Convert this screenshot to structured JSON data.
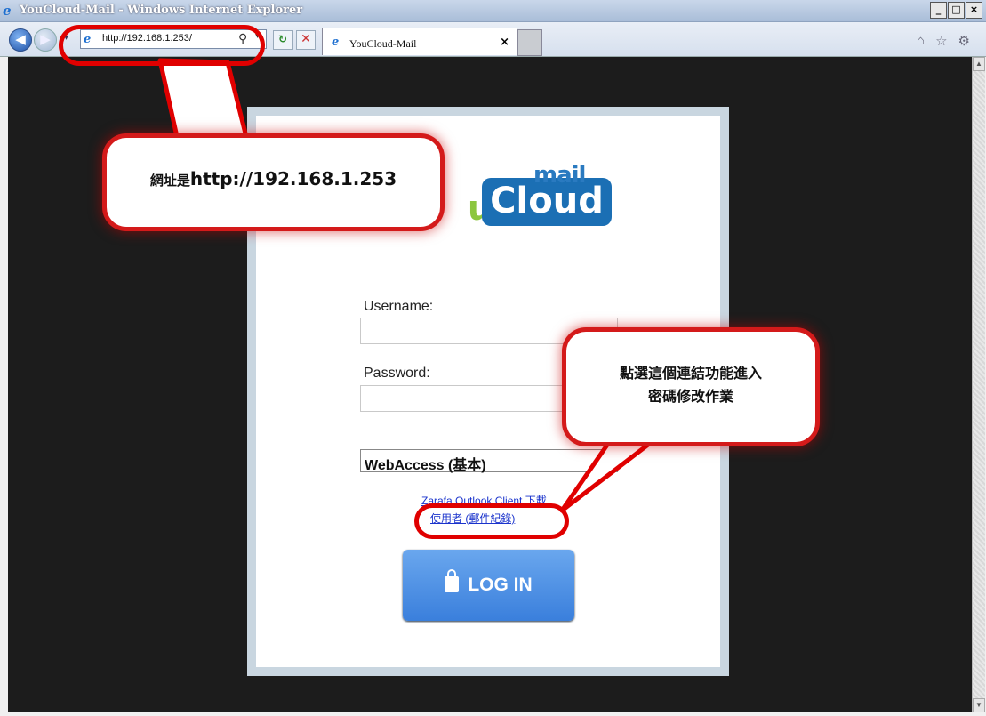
{
  "window": {
    "title": "YouCloud-Mail - Windows Internet Explorer",
    "min": "_",
    "max": "□",
    "close": "×"
  },
  "nav": {
    "back": "◀",
    "forward": "▶",
    "history": "▾",
    "url": "http://192.168.1.253/",
    "search_icon": "⚲",
    "dropdown": "▾",
    "refresh": "↻",
    "stop": "✕"
  },
  "tab": {
    "label": "YouCloud-Mail",
    "close": "×"
  },
  "tools": {
    "home": "⌂",
    "favorites": "☆",
    "settings": "⚙"
  },
  "logo": {
    "mail": "mail",
    "cloud": "Cloud",
    "u": "u"
  },
  "form": {
    "username_label": "Username:",
    "username_value": "",
    "password_label": "Password:",
    "password_value": "",
    "client_select": "WebAccess (基本)",
    "link_outlook": "Zarafa Outlook Client 下載",
    "link_user": "使用者 (郵件紀錄)",
    "login_label": "LOG IN"
  },
  "callouts": {
    "url_note_prefix": "網址是",
    "url_note_url": "http://192.168.1.253",
    "link_note_line1": "點選這個連結功能進入",
    "link_note_line2": "密碼修改作業"
  },
  "colors": {
    "accent": "#3a7fdc",
    "annotation": "#e00000",
    "background": "#1c1c1c"
  }
}
